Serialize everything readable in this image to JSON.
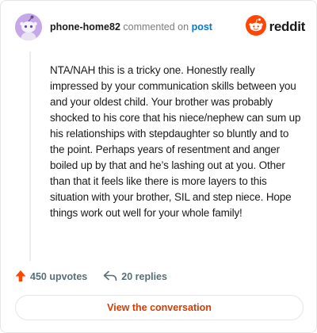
{
  "header": {
    "username": "phone-home82",
    "action_text": "commented on",
    "post_link_text": "post",
    "logo_text": "reddit",
    "avatar_icon": "snoo-avatar-icon",
    "logo_icon": "reddit-snoo-icon"
  },
  "comment": {
    "body": "NTA/NAH this is a tricky one. Honestly really impressed by your communication skills between you and your oldest child. Your brother was probably shocked to his core that his niece/nephew can sum up his relationships with stepdaughter so bluntly and to the point. Perhaps years of resentment and anger boiled up by that and he’s lashing out at you. Other than that it feels like there is more layers to this situation with your brother, SIL and step niece. Hope things work out well for your whole family!"
  },
  "stats": {
    "upvotes_label": "450 upvotes",
    "replies_label": "20 replies",
    "upvote_icon": "upvote-arrow-icon",
    "reply_icon": "reply-arrow-icon"
  },
  "actions": {
    "view_conversation_label": "View the conversation"
  },
  "colors": {
    "accent": "#d93a00",
    "upvote": "#ff4500",
    "link": "#0079d3",
    "avatar_bg": "#c6a7e8",
    "muted_text": "#576f76"
  }
}
